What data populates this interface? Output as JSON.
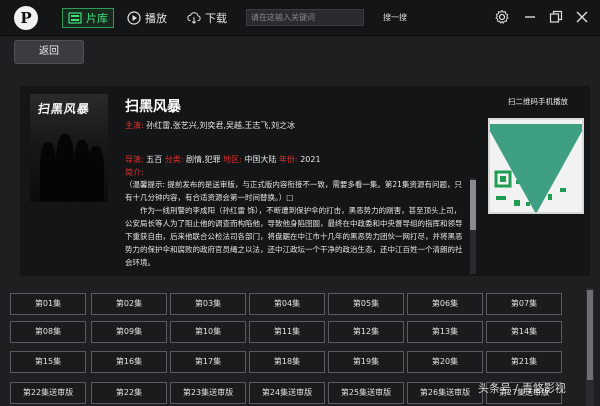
{
  "titlebar": {
    "logo_letter": "P",
    "tabs": [
      {
        "label": "片库",
        "icon": "library-icon",
        "active": true
      },
      {
        "label": "播放",
        "icon": "play-icon",
        "active": false
      },
      {
        "label": "下载",
        "icon": "download-icon",
        "active": false
      }
    ],
    "search_placeholder": "请在这输入关键词",
    "search_button": "搜一搜"
  },
  "toolbar": {
    "back_label": "返回"
  },
  "movie": {
    "title": "扫黑风暴",
    "poster_title": "扫黑风暴",
    "cast_label": "主演:",
    "cast": "孙红雷,张艺兴,刘奕君,吴越,王志飞,刘之冰",
    "director_label": "导演:",
    "director": "五百",
    "genre_label": "分类:",
    "genre": "剧情,犯罪",
    "region_label": "地区:",
    "region": "中国大陆",
    "year_label": "年份:",
    "year": "2021",
    "intro_label": "简介:",
    "intro_first": "（温馨提示: 提前发布的是送审版，与正式版内容衔接不一致，需要多看一集。第21集资源有问题，只有十几分钟内容，有合适资源会第一时间替换。）□",
    "intro_rest": "作为一线刑警的李成阳（孙红雷 饰），不断遭到保护伞的打击，黑恶势力的刚害，甚至顶头上司，公安局长等人为了阻止他的调查而构陷他，导致他身陷囹圄，最终在中政委和中央督导组的指挥和领导下重获自由，后来他联合公检法司各部门，将盘踞在中江市十几年的黑恶势力团伙一网打尽，并将黑恶势力的保护伞和腐败的政府官员绳之以法，还中江政坛一个干净的政治生态，还中江百姓一个清朗的社会环境。"
  },
  "qr": {
    "label": "扫二维码手机播放"
  },
  "episodes": [
    "第01集",
    "第02集",
    "第03集",
    "第04集",
    "第05集",
    "第06集",
    "第07集",
    "第08集",
    "第09集",
    "第10集",
    "第11集",
    "第12集",
    "第13集",
    "第14集",
    "第15集",
    "第16集",
    "第17集",
    "第18集",
    "第19集",
    "第20集",
    "第21集",
    "第22集送审版",
    "第22集",
    "第23集送审版",
    "第24集送审版",
    "第25集送审版",
    "第26集送审版",
    "第27集送审版"
  ],
  "watermark": "头条号 / 青悠影视",
  "colors": {
    "accent": "#3fe07a",
    "label_red": "#e0312f",
    "background": "#1e1f21"
  }
}
